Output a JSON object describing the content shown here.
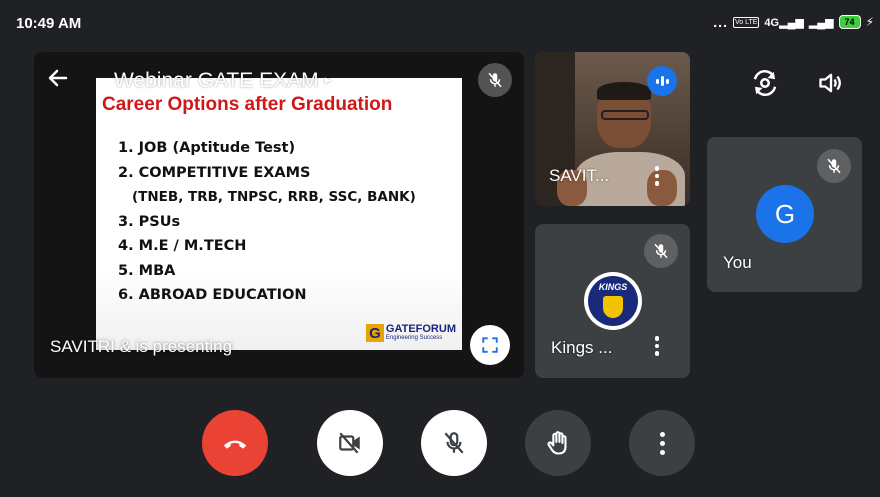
{
  "status_bar": {
    "time": "10:49 AM",
    "overflow_dots": "...",
    "volte": "Vo LTE",
    "network": "4G",
    "battery": "74"
  },
  "presentation": {
    "title": "Webinar GATE EXAM",
    "title_arrow": "▸",
    "presenting_label": "SAVITRI & is presenting",
    "slide": {
      "title": "Career Options after Graduation",
      "items": [
        "1. JOB (Aptitude Test)",
        "2. COMPETITIVE EXAMS",
        "(TNEB, TRB, TNPSC, RRB, SSC, BANK)",
        "3. PSUs",
        "4. M.E / M.TECH",
        "5. MBA",
        "6. ABROAD EDUCATION"
      ],
      "logo_letter": "G",
      "logo_name": "GATEFORUM",
      "logo_tagline": "Engineering Success"
    }
  },
  "participants": {
    "savitri": {
      "name": "SAVIT..."
    },
    "kings": {
      "name": "Kings ...",
      "logo_text": "KINGS"
    },
    "you": {
      "name": "You",
      "avatar_letter": "G",
      "avatar_color": "#1a73e8"
    }
  },
  "icons": {
    "back": "arrow-left-icon",
    "switch_camera": "switch-camera-icon",
    "speaker": "speaker-icon",
    "mic_off": "mic-off-icon",
    "fullscreen": "fullscreen-icon",
    "end_call": "end-call-icon",
    "camera_off": "camera-off-icon",
    "raise_hand": "raise-hand-icon",
    "more": "more-vert-icon"
  },
  "colors": {
    "background": "#202124",
    "end_call": "#ea4335",
    "accent_blue": "#1a73e8",
    "slide_title_red": "#d01818"
  }
}
